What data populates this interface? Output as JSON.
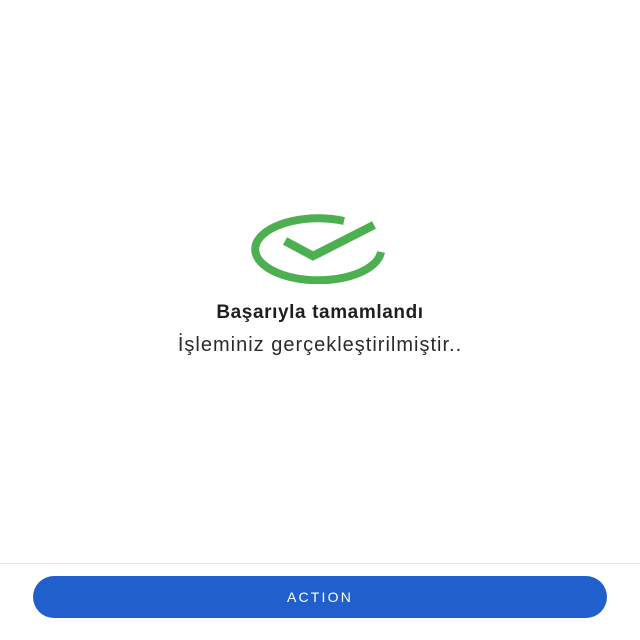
{
  "result": {
    "icon": "check-circle-icon",
    "icon_color": "#4caf50",
    "title": "Başarıyla tamamlandı",
    "message": "İşleminiz gerçekleştirilmiştir.."
  },
  "footer": {
    "action_label": "ACTION",
    "button_color": "#2160cc"
  }
}
